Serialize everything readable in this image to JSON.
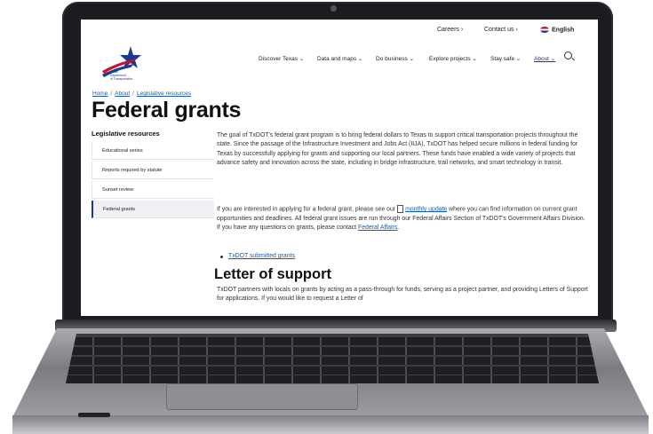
{
  "topbar": {
    "careers": "Careers ›",
    "contact": "Contact us ›",
    "language": "English"
  },
  "logo": {
    "line1": "Texas",
    "line2": "Department",
    "line3": "of Transportation"
  },
  "nav": [
    {
      "label": "Discover Texas ⌄"
    },
    {
      "label": "Data and maps ⌄"
    },
    {
      "label": "Do business ⌄"
    },
    {
      "label": "Explore projects ⌄"
    },
    {
      "label": "Stay safe ⌄"
    },
    {
      "label": "About ⌄"
    }
  ],
  "breadcrumb": {
    "home": "Home",
    "about": "About",
    "current": "Legislative resources",
    "separator": "/"
  },
  "page_title": "Federal grants",
  "sidebar": {
    "title": "Legislative resources",
    "items": [
      {
        "label": "Educational series"
      },
      {
        "label": "Reports required by statute"
      },
      {
        "label": "Sunset review"
      },
      {
        "label": "Federal grants"
      }
    ]
  },
  "content": {
    "para1": "The goal of TxDOT's federal grant program is to bring federal dollars to Texas to support critical transportation projects throughout the state. Since the passage of the Infrastructure Investment and Jobs Act (IIJA), TxDOT has helped secure millions in federal funding for Texas by successfully applying for grants and supporting our local partners. These funds have enabled a wide variety of projects that advance safety and innovation across the state, including in bridge infrastructure, trail networks, and smart technology in transit.",
    "para2_a": "If you are interested in applying for a federal grant, please see our",
    "para2_link": "monthly update",
    "para2_b": "where you can find information on current grant opportunities and deadlines. All federal grant issues are run through our Federal Affairs Section of TxDOT's Government Affairs Division. If you have any questions on grants, please contact",
    "para2_link2": "Federal Affairs",
    "para2_end": ".",
    "bullet": "TxDOT submitted grants",
    "heading2": "Letter of support",
    "para3": "TxDOT partners with locals on grants by acting as a pass-through for funds, serving as a project partner, and providing Letters of Support for applications. If you would like to request a Letter of"
  },
  "colors": {
    "brand": "#1a3a8c",
    "link": "#1a5aa8",
    "accent_red": "#c8102e"
  }
}
